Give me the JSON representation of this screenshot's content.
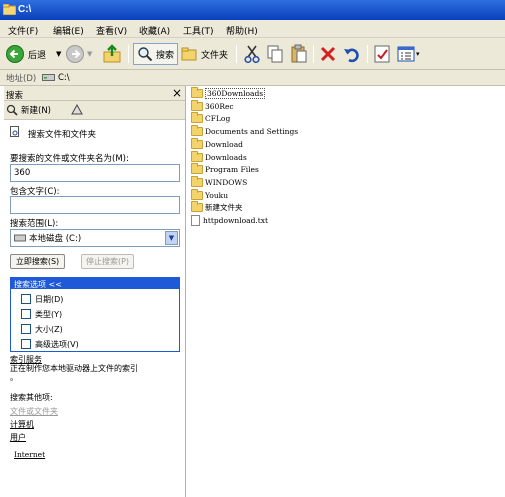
{
  "window": {
    "title": "C:\\"
  },
  "menu": [
    "文件(F)",
    "编辑(E)",
    "查看(V)",
    "收藏(A)",
    "工具(T)",
    "帮助(H)"
  ],
  "toolbar": {
    "back_label": "后退",
    "search_label": "搜索",
    "folders_label": "文件夹"
  },
  "address": {
    "label": "地址(D)",
    "value": "C:\\"
  },
  "search_pane": {
    "title": "搜索",
    "close": "×",
    "new_label": "新建(N)",
    "heading": "搜索文件和文件夹",
    "name_label": "要搜索的文件或文件夹名为(M):",
    "name_value": "360",
    "contains_label": "包含文字(C):",
    "contains_value": "",
    "scope_label": "搜索范围(L):",
    "scope_value": "本地磁盘 (C:)",
    "search_now": "立即搜索(S)",
    "stop_search": "停止搜索(P)",
    "options_header": "搜索选项 <<",
    "options": [
      "日期(D)",
      "类型(Y)",
      "大小(Z)",
      "高级选项(V)"
    ],
    "index_service": "索引服务",
    "index_desc": "正在制作您本地驱动器上文件的索引",
    "index_dot": "。",
    "other_label": "搜索其他项:",
    "other_links": [
      "文件或文件夹",
      "计算机",
      "用户"
    ],
    "internet": "Internet"
  },
  "files": [
    {
      "name": "360Downloads",
      "type": "folder"
    },
    {
      "name": "360Rec",
      "type": "folder"
    },
    {
      "name": "CFLog",
      "type": "folder"
    },
    {
      "name": "Documents and Settings",
      "type": "folder"
    },
    {
      "name": "Download",
      "type": "folder"
    },
    {
      "name": "Downloads",
      "type": "folder"
    },
    {
      "name": "Program Files",
      "type": "folder"
    },
    {
      "name": "WINDOWS",
      "type": "folder"
    },
    {
      "name": "Youku",
      "type": "folder"
    },
    {
      "name": "新建文件夹",
      "type": "folder"
    },
    {
      "name": "httpdownload.txt",
      "type": "file"
    }
  ],
  "colors": {
    "titlebar": "#0a3fba",
    "options_header": "#1e5ad8",
    "chrome": "#ece9d8"
  }
}
